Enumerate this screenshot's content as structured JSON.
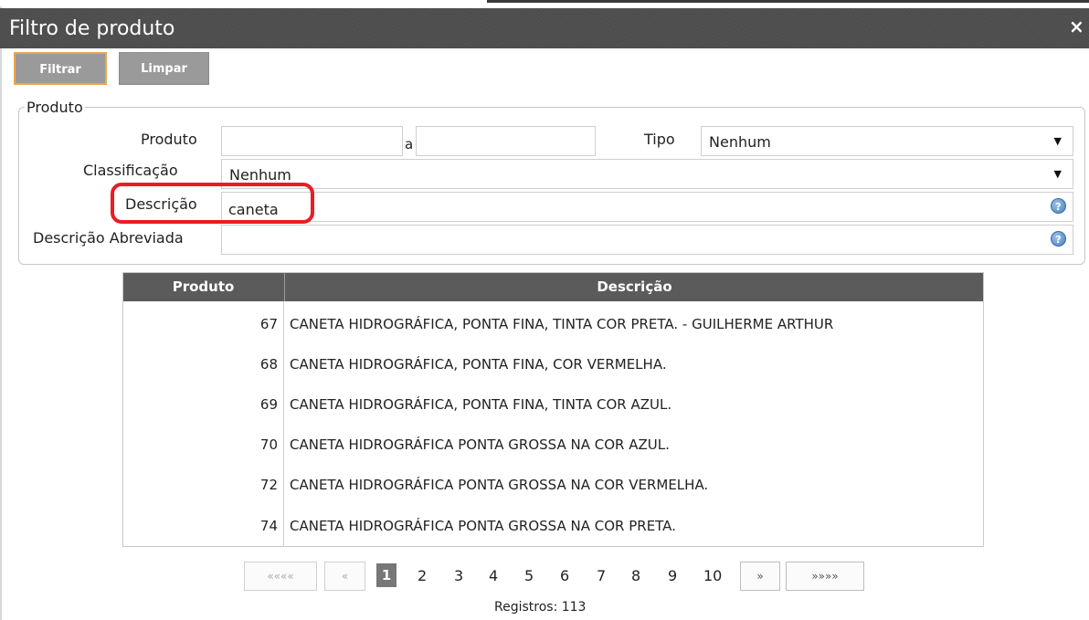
{
  "dialog": {
    "title": "Filtro de produto",
    "close_icon": "×"
  },
  "toolbar": {
    "filter_label": "Filtrar",
    "clear_label": "Limpar"
  },
  "group": {
    "legend": "Produto",
    "produto_label": "Produto",
    "produto_from": "",
    "range_sep": "a",
    "produto_to": "",
    "tipo_label": "Tipo",
    "tipo_value": "Nenhum",
    "classificacao_label": "Classificação",
    "classificacao_value": "Nenhum",
    "descricao_label": "Descrição",
    "descricao_value": "caneta",
    "descricao_abrev_label": "Descrição Abreviada",
    "descricao_abrev_value": "",
    "help_glyph": "?",
    "caret_glyph": "▼"
  },
  "table": {
    "headers": [
      "Produto",
      "Descrição"
    ],
    "rows": [
      {
        "produto": "67",
        "descricao": "CANETA HIDROGRÁFICA, PONTA FINA, TINTA COR PRETA. - GUILHERME ARTHUR"
      },
      {
        "produto": "68",
        "descricao": "CANETA HIDROGRÁFICA, PONTA FINA, COR VERMELHA."
      },
      {
        "produto": "69",
        "descricao": "CANETA HIDROGRÁFICA, PONTA FINA, TINTA COR AZUL."
      },
      {
        "produto": "70",
        "descricao": "CANETA HIDROGRÁFICA PONTA GROSSA NA COR AZUL."
      },
      {
        "produto": "72",
        "descricao": "CANETA HIDROGRÁFICA PONTA GROSSA NA COR VERMELHA."
      },
      {
        "produto": "74",
        "descricao": "CANETA HIDROGRÁFICA PONTA GROSSA NA COR PRETA."
      }
    ]
  },
  "pagination": {
    "first": "«««« ",
    "prev": "«",
    "pages": [
      "1",
      "2",
      "3",
      "4",
      "5",
      "6",
      "7",
      "8",
      "9",
      "10"
    ],
    "current_page": "1",
    "next": "»",
    "last": "»»»»",
    "records_label": "Registros: 113"
  },
  "colors": {
    "titlebar": "#4d4d4d",
    "button": "#9a9a9a",
    "button_focus_border": "#e8a84f",
    "table_header": "#5b5b5b",
    "annotation_red": "#ea1c24"
  }
}
